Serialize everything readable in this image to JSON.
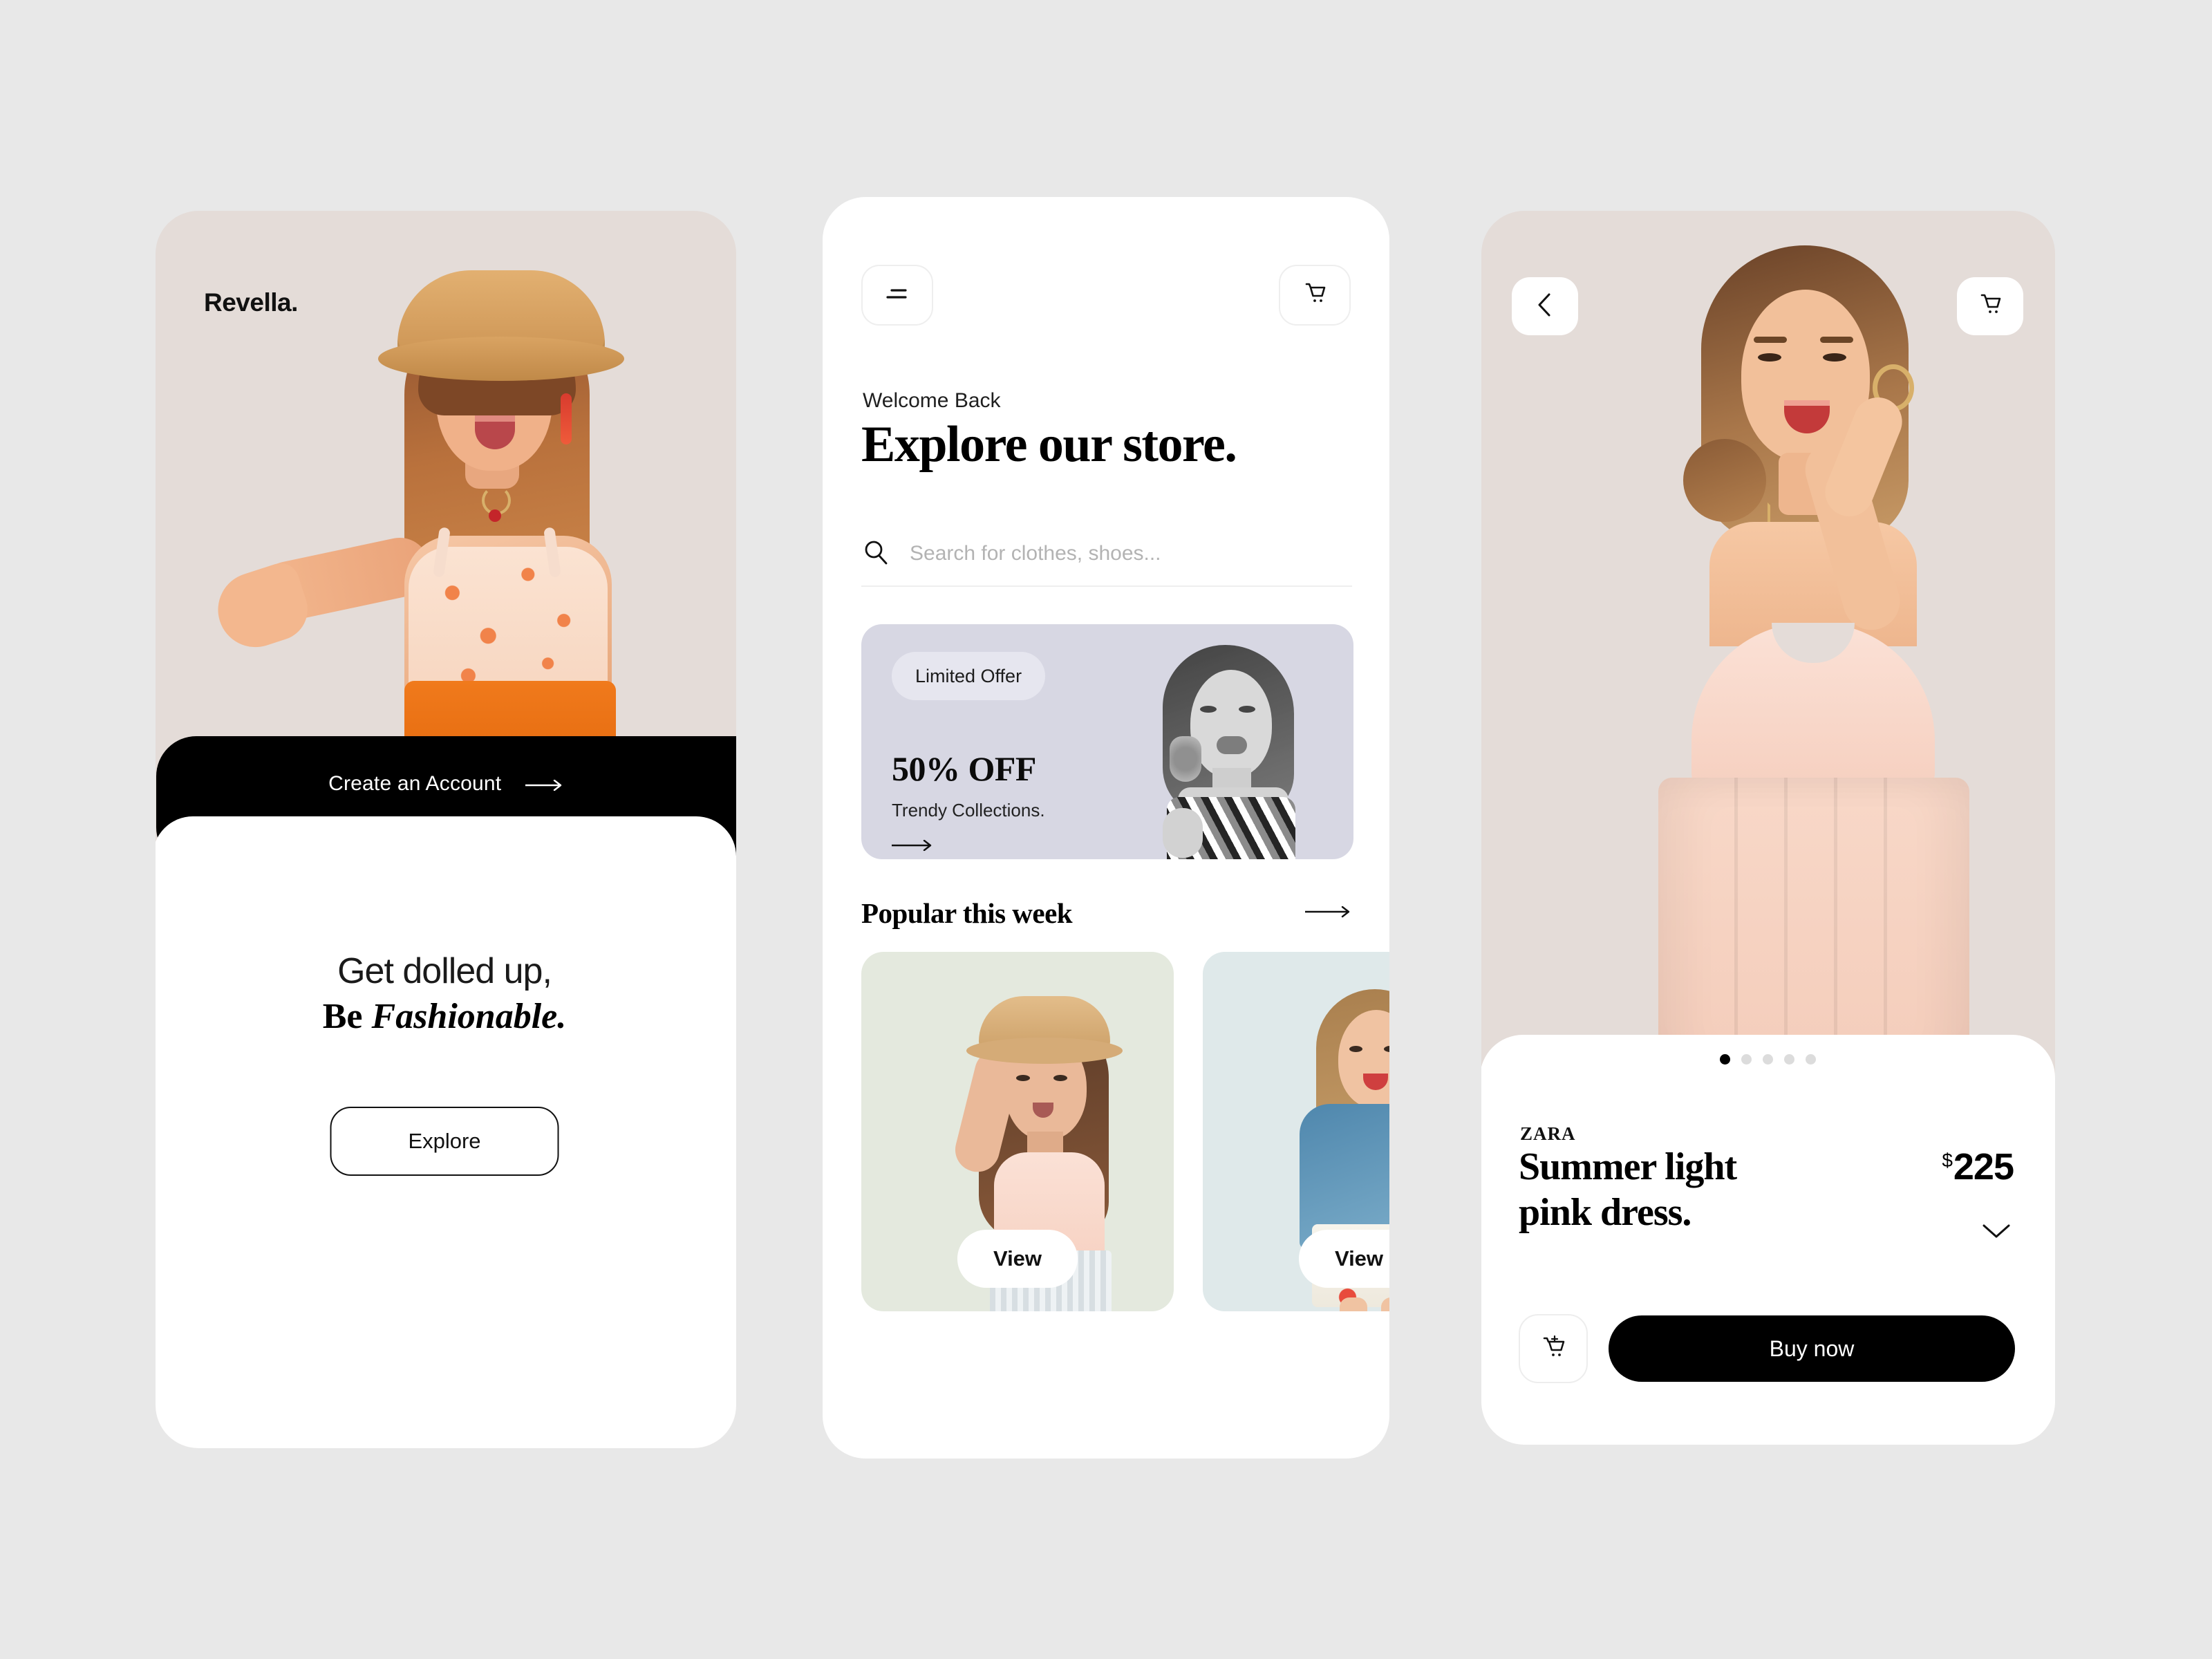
{
  "canvas": {
    "background": "#e8e8e8"
  },
  "screen_onboarding": {
    "logo": "Revella.",
    "hero_bg": "#e4dcd8",
    "create_account": {
      "label": "Create an Account",
      "icon": "arrow-right-icon"
    },
    "headline_line1": "Get dolled up,",
    "headline_line2_plain": "Be ",
    "headline_line2_italic": "Fashionable.",
    "explore_button": "Explore"
  },
  "screen_store": {
    "menu_icon": "hamburger-menu-icon",
    "cart_icon": "shopping-cart-icon",
    "welcome": "Welcome Back",
    "title": "Explore our store.",
    "search": {
      "icon": "search-icon",
      "placeholder": "Search for clothes, shoes...",
      "value": ""
    },
    "banner": {
      "bg": "#d7d7e3",
      "pill_bg": "#e6e6ef",
      "badge": "Limited Offer",
      "discount": "50% OFF",
      "subtitle": "Trendy Collections.",
      "cta_icon": "arrow-right-icon"
    },
    "section": {
      "title": "Popular this week",
      "more_icon": "arrow-right-icon"
    },
    "products": [
      {
        "view_label": "View",
        "bg": "#e4e9de"
      },
      {
        "view_label": "View",
        "bg": "#dfe9ea"
      }
    ]
  },
  "screen_product": {
    "back_icon": "chevron-left-icon",
    "cart_icon": "shopping-cart-icon",
    "hero_bg": "#e4dcd8",
    "carousel": {
      "total": 5,
      "active": 1
    },
    "brand": "ZARA",
    "name_line1": "Summer light",
    "name_line2": "pink dress.",
    "currency": "$",
    "price": "225",
    "expand_icon": "chevron-down-icon",
    "add_to_cart_icon": "cart-plus-icon",
    "buy_button": "Buy now",
    "accent": "#000000"
  }
}
